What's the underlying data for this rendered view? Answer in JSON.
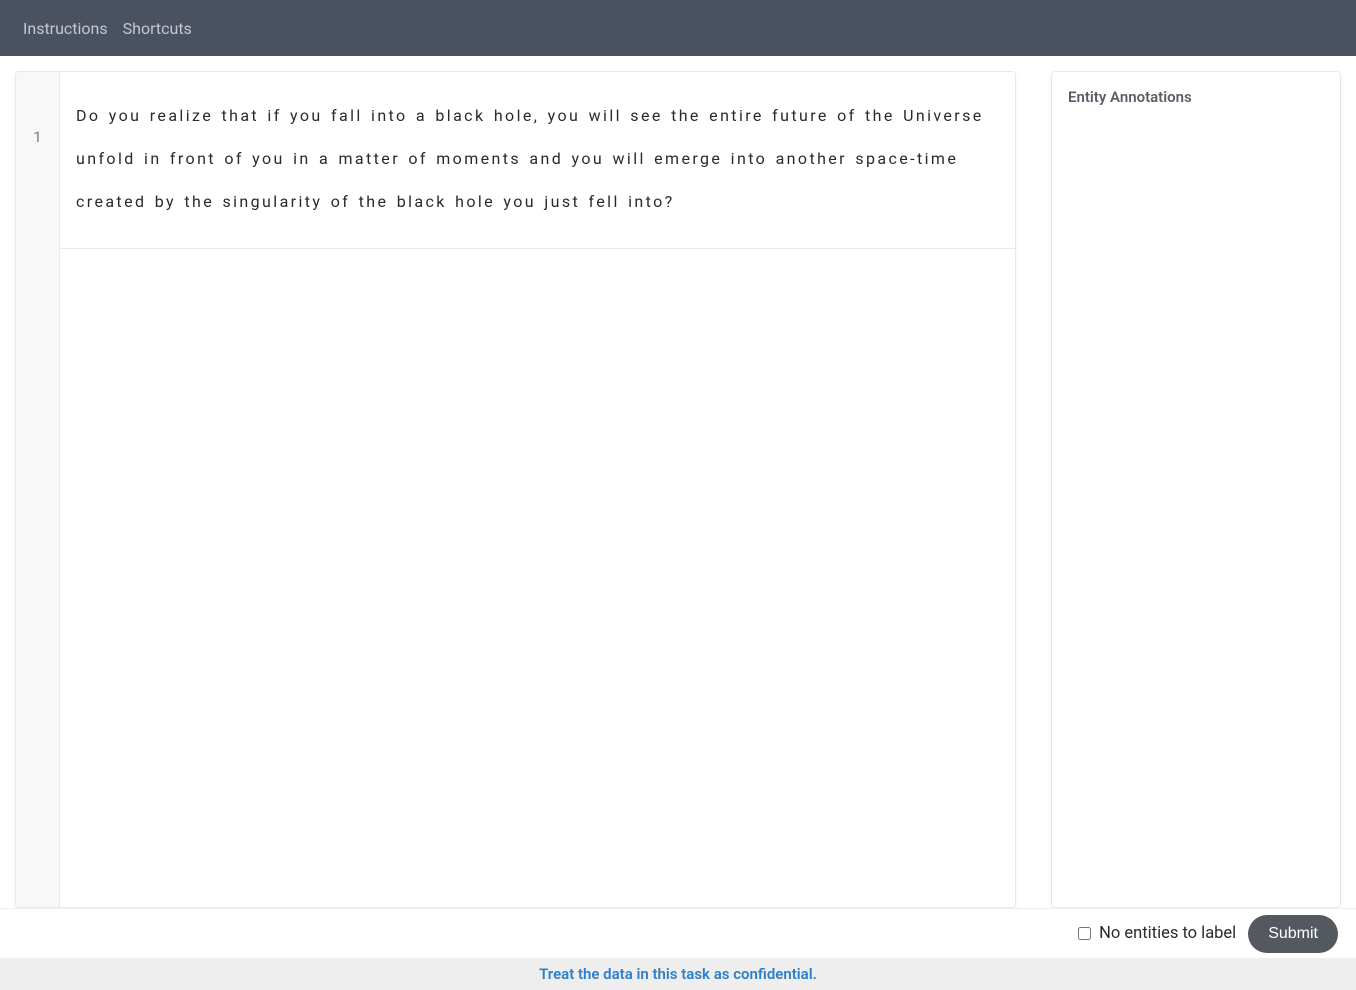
{
  "header": {
    "instructions": "Instructions",
    "shortcuts": "Shortcuts"
  },
  "editor": {
    "line_number": "1",
    "text": "Do you realize that if you fall into a black hole, you will see the entire future of the Universe unfold in front of you in a matter of moments and you will emerge into another space-time created by the singularity of the black hole you just fell into?"
  },
  "sidebar": {
    "title": "Entity Annotations"
  },
  "footer": {
    "no_entities_label": "No entities to label",
    "submit_label": "Submit"
  },
  "confidential": {
    "message": "Treat the data in this task as confidential."
  }
}
